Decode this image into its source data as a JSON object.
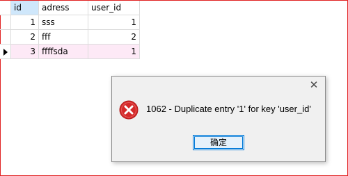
{
  "grid": {
    "columns": [
      "id",
      "adress",
      "user_id"
    ],
    "rows": [
      {
        "id": "1",
        "adress": "sss",
        "user_id": "1"
      },
      {
        "id": "2",
        "adress": "fff",
        "user_id": "2"
      },
      {
        "id": "3",
        "adress": "ffffsda",
        "user_id": "1"
      }
    ],
    "current_row": 3
  },
  "dialog": {
    "message": "1062 - Duplicate entry '1' for key 'user_id'",
    "ok_label": "确定",
    "icon": "error-icon",
    "close_icon": "close-icon"
  },
  "colors": {
    "header_selected": "#cfe7fb",
    "current_row": "#fde9f6",
    "border": "#e02020",
    "error_red": "#d42a2a"
  }
}
